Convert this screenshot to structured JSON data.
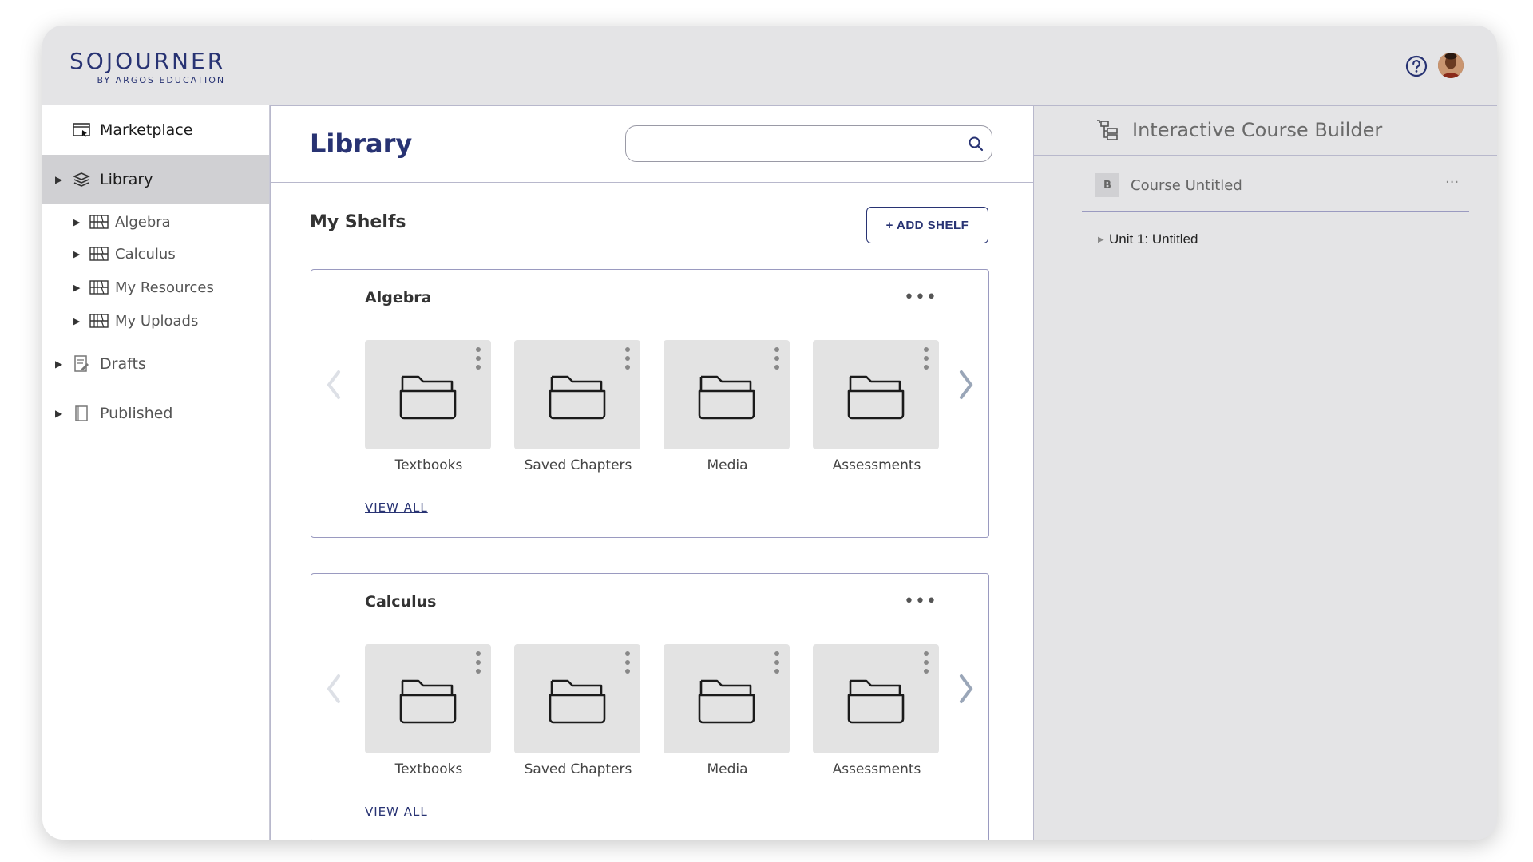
{
  "brand": {
    "name": "SOJOURNER",
    "sub": "BY ARGOS EDUCATION"
  },
  "header": {
    "help_icon": "question-circle-icon",
    "avatar": "user-avatar"
  },
  "sidebar": {
    "marketplace": "Marketplace",
    "library": "Library",
    "library_children": [
      "Algebra",
      "Calculus",
      "My Resources",
      "My Uploads"
    ],
    "drafts": "Drafts",
    "published": "Published"
  },
  "main": {
    "title": "Library",
    "search": {
      "value": "",
      "placeholder": ""
    },
    "shelves_title": "My Shelfs",
    "add_shelf_label": "+ ADD SHELF",
    "shelves": [
      {
        "name": "Algebra",
        "menu": "•••",
        "folders": [
          "Textbooks",
          "Saved Chapters",
          "Media",
          "Assessments"
        ],
        "view_all": "VIEW ALL"
      },
      {
        "name": "Calculus",
        "menu": "•••",
        "folders": [
          "Textbooks",
          "Saved Chapters",
          "Media",
          "Assessments"
        ],
        "view_all": "VIEW ALL"
      }
    ]
  },
  "builder": {
    "title": "Interactive Course Builder",
    "course_badge": "B",
    "course_name": "Course Untitled",
    "course_menu": "···",
    "units": [
      "Unit 1: Untitled"
    ]
  },
  "colors": {
    "brand": "#283373",
    "panel_bg": "#e4e4e6",
    "tile_bg": "#e3e3e3",
    "active_nav": "#d0d0d3"
  }
}
